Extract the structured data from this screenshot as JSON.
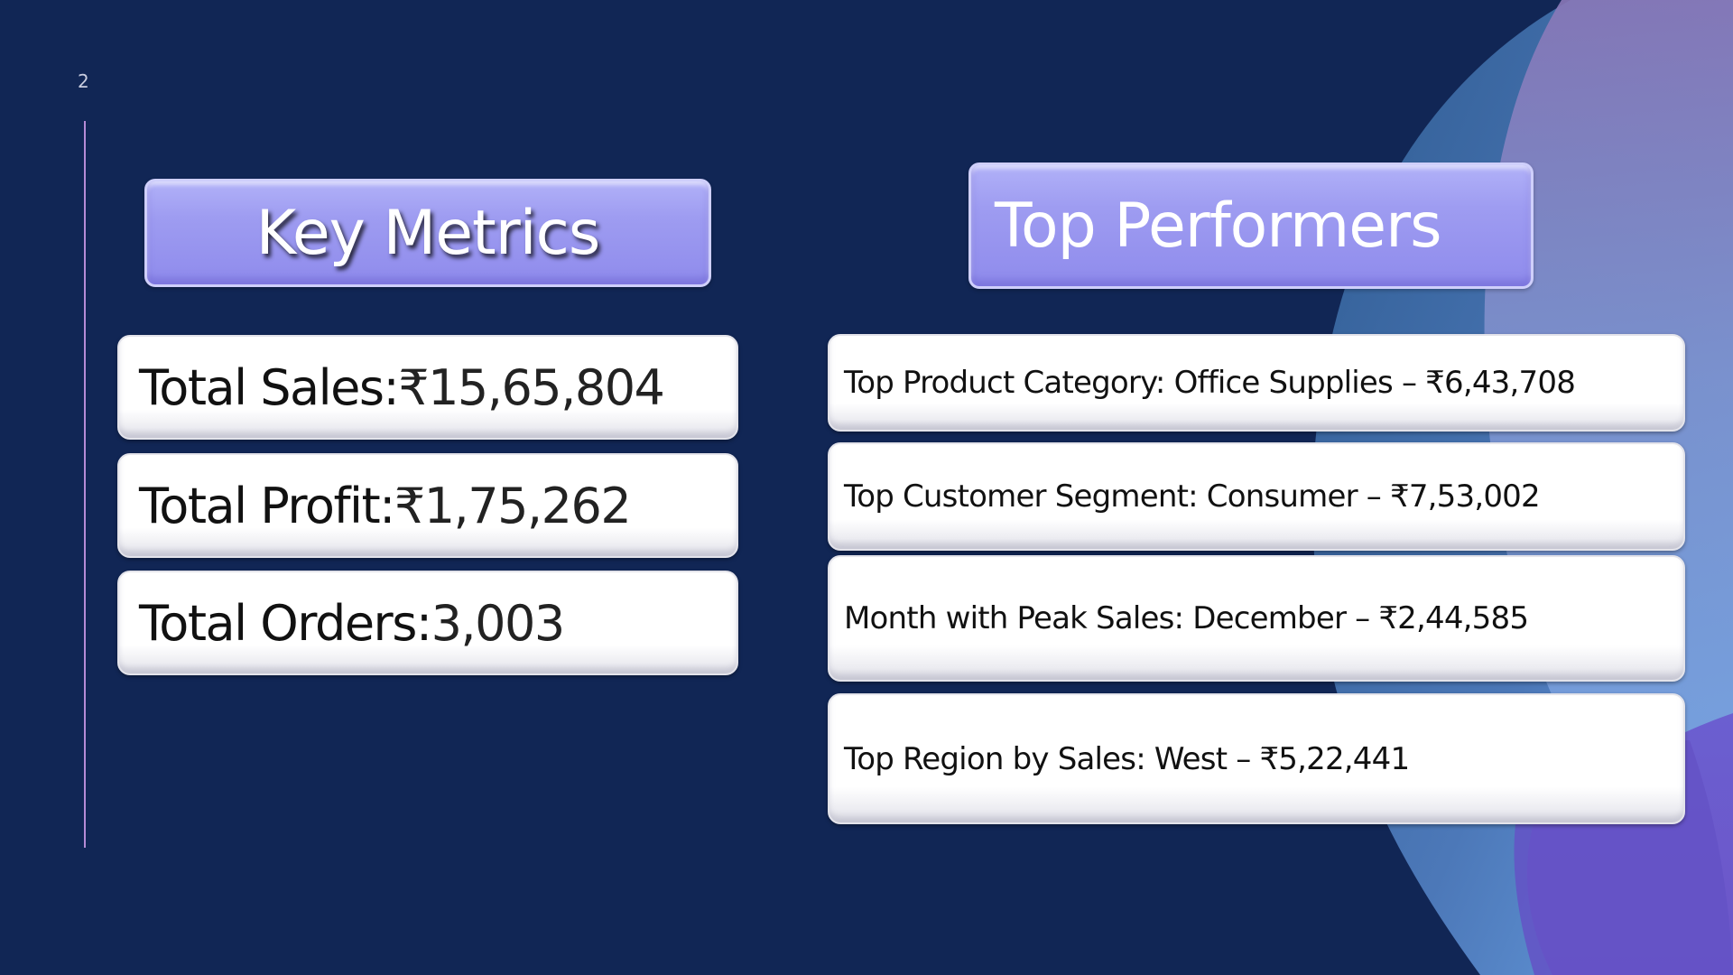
{
  "slide": {
    "number": "2"
  },
  "colors": {
    "background": "#112655",
    "title_box": "#9e9cf1",
    "card": "#ffffff",
    "accent_line": "#b58bd6"
  },
  "key_metrics": {
    "title": "Key Metrics",
    "items": [
      {
        "label": "Total Sales",
        "separator": ":",
        "value": " ₹15,65,804"
      },
      {
        "label": "Total Profit",
        "separator": ":",
        "value": " ₹1,75,262"
      },
      {
        "label": "Total Orders",
        "separator": ":",
        "value": " 3,003"
      }
    ]
  },
  "top_performers": {
    "title": "Top Performers",
    "items": [
      {
        "text": "Top Product Category: Office Supplies – ₹6,43,708"
      },
      {
        "text": "Top Customer Segment: Consumer – ₹7,53,002"
      },
      {
        "text": "Month with Peak Sales: December – ₹2,44,585"
      },
      {
        "text": "Top Region by Sales: West – ₹5,22,441"
      }
    ]
  }
}
